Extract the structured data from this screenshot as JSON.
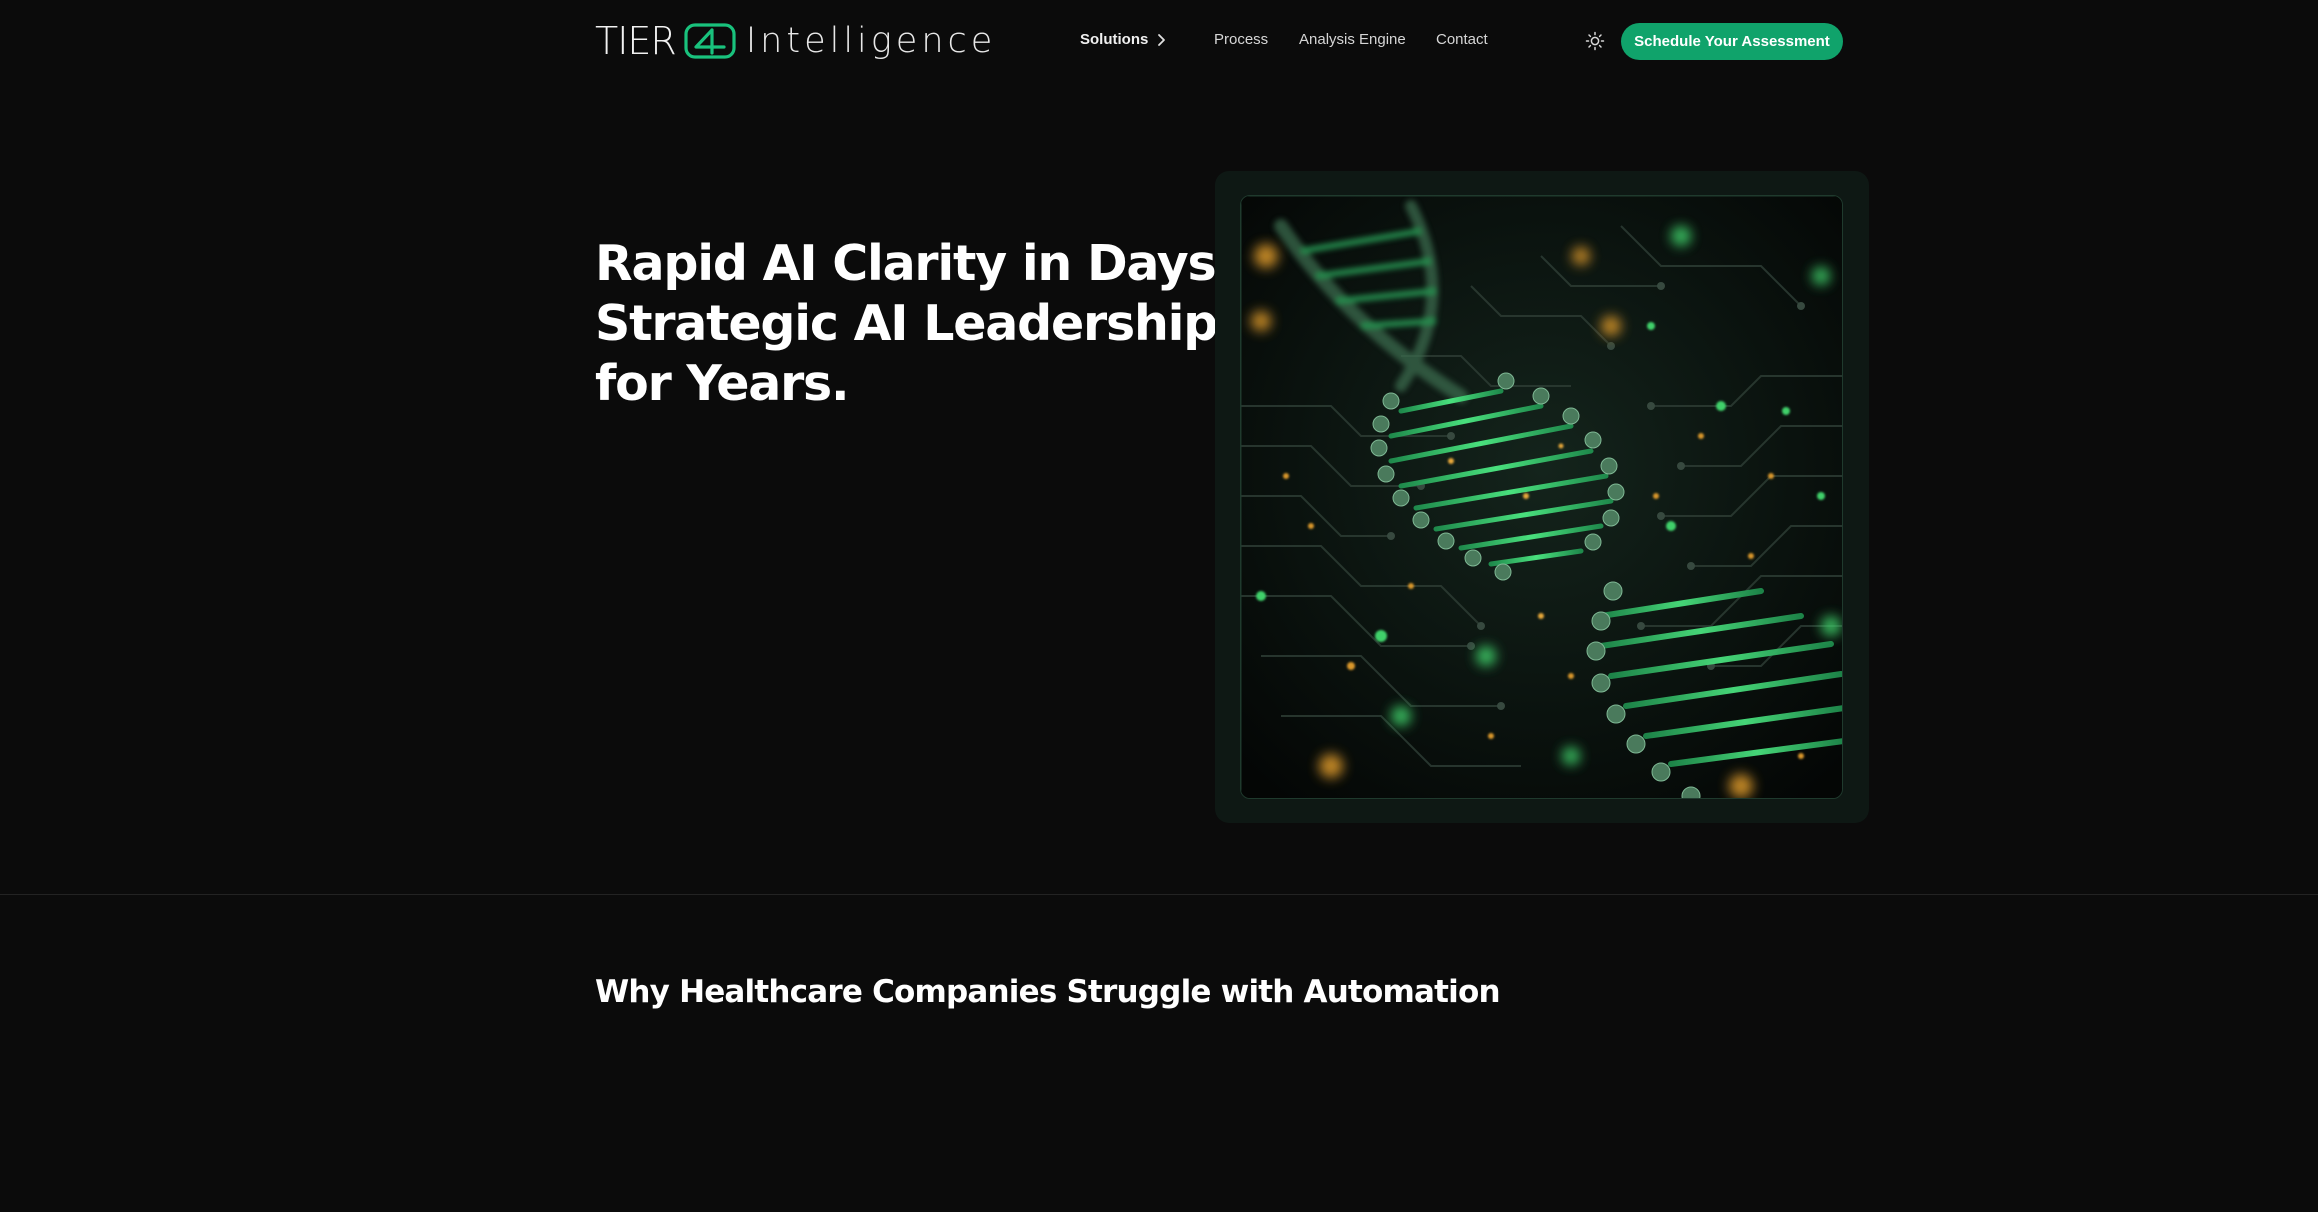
{
  "brand": {
    "name_part1": "TIER",
    "name_part2": "Intelligence",
    "accent_color": "#10a36b"
  },
  "nav": {
    "items": [
      {
        "label": "Solutions",
        "has_submenu": true,
        "icon": "chevron-right-icon"
      },
      {
        "label": "Process"
      },
      {
        "label": "Analysis Engine"
      },
      {
        "label": "Contact"
      }
    ],
    "theme_toggle_icon": "sun-icon",
    "cta_label": "Schedule Your Assessment"
  },
  "hero": {
    "title_lines": [
      "Rapid AI Clarity in Days.",
      "Strategic AI Leadership",
      "for Years."
    ],
    "image_subject": "dna-helix-circuit-image"
  },
  "section": {
    "heading": "Why Healthcare Companies Struggle with Automation"
  }
}
